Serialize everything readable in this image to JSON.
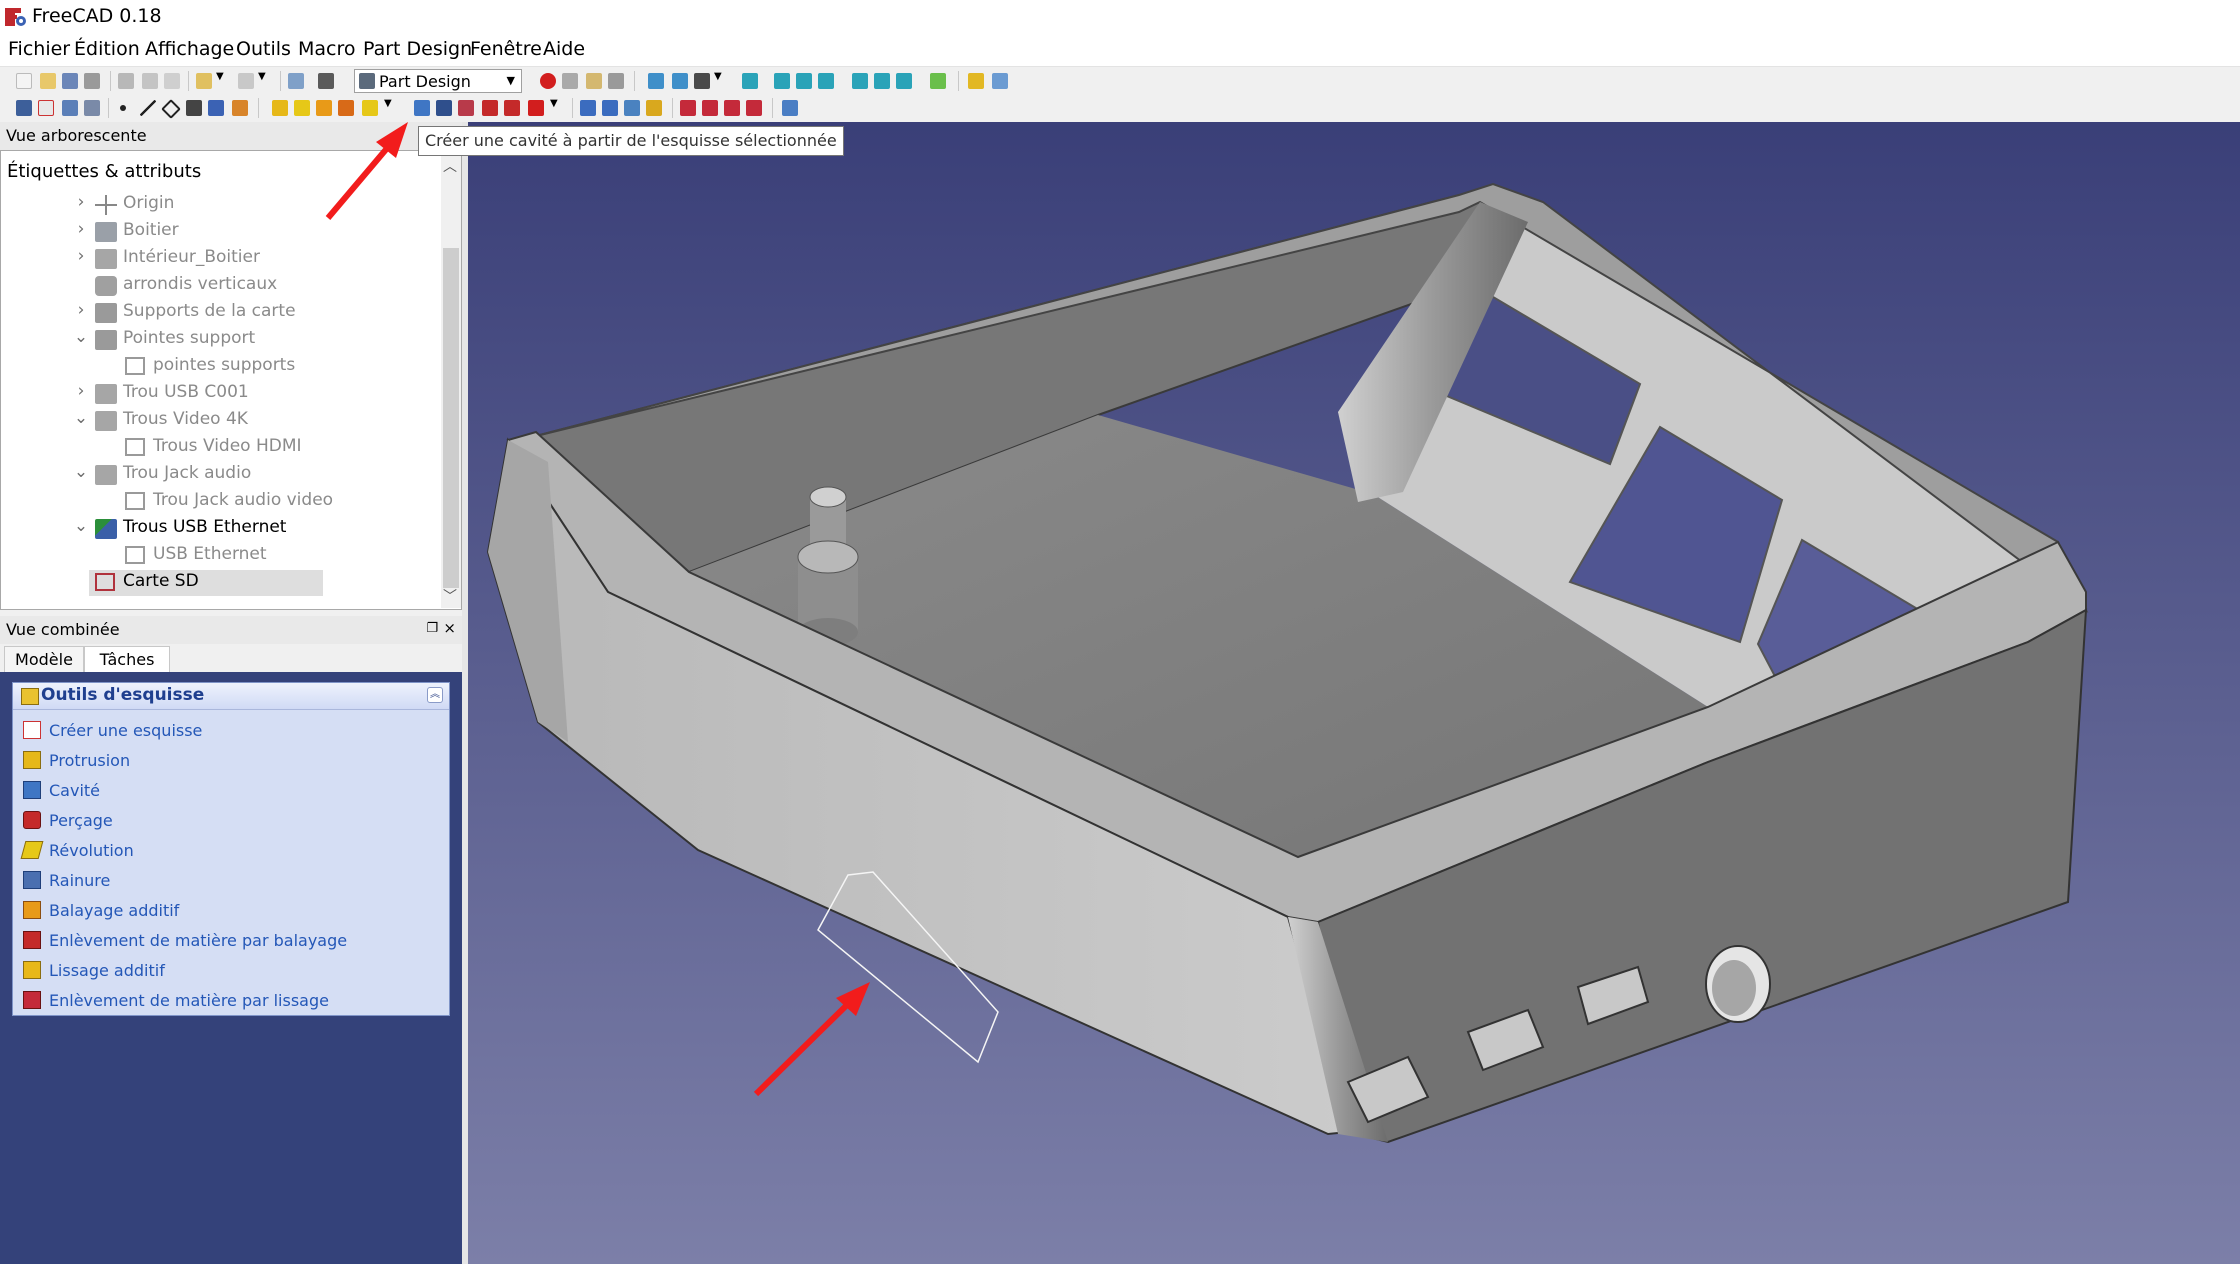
{
  "app": {
    "title": "FreeCAD 0.18"
  },
  "menu": [
    "Fichier",
    "Édition",
    "Affichage",
    "Outils",
    "Macro",
    "Part Design",
    "Fenêtre",
    "Aide"
  ],
  "toolbar": {
    "workbench": "Part Design"
  },
  "tooltip": "Créer une cavité à partir de l'esquisse sélectionnée",
  "tree": {
    "panel_title": "Vue arborescente",
    "column_header": "Étiquettes & attributs",
    "items": [
      {
        "label": "Origin",
        "icon": "origin-icon",
        "expander": "collapsed",
        "level": 0
      },
      {
        "label": "Boitier",
        "icon": "body-icon",
        "expander": "collapsed",
        "level": 0
      },
      {
        "label": "Intérieur_Boitier",
        "icon": "pocket-feature-icon",
        "expander": "collapsed",
        "level": 0
      },
      {
        "label": "arrondis verticaux",
        "icon": "fillet-feature-icon",
        "expander": "none",
        "level": 0
      },
      {
        "label": "Supports de la carte",
        "icon": "pad-feature-icon",
        "expander": "collapsed",
        "level": 0
      },
      {
        "label": "Pointes support",
        "icon": "pad-feature-icon",
        "expander": "expanded",
        "level": 0
      },
      {
        "label": "pointes supports",
        "icon": "sketch-icon",
        "expander": "none",
        "level": 1
      },
      {
        "label": "Trou USB C001",
        "icon": "pocket-feature-icon",
        "expander": "collapsed",
        "level": 0
      },
      {
        "label": "Trous Video 4K",
        "icon": "pocket-feature-icon",
        "expander": "expanded",
        "level": 0
      },
      {
        "label": "Trous Video HDMI",
        "icon": "sketch-icon",
        "expander": "none",
        "level": 1
      },
      {
        "label": "Trou Jack audio",
        "icon": "pocket-feature-icon",
        "expander": "expanded",
        "level": 0
      },
      {
        "label": "Trou Jack audio video",
        "icon": "sketch-icon",
        "expander": "none",
        "level": 1
      },
      {
        "label": "Trous USB Ethernet",
        "icon": "pocket-feature-tip-icon",
        "expander": "expanded",
        "level": 0,
        "active": true
      },
      {
        "label": "USB Ethernet",
        "icon": "sketch-icon",
        "expander": "none",
        "level": 1
      },
      {
        "label": "Carte SD",
        "icon": "sketch-selected-icon",
        "expander": "none",
        "level": 0,
        "active": true,
        "selected": true
      }
    ]
  },
  "combo": {
    "title": "Vue combinée",
    "tabs": [
      "Modèle",
      "Tâches"
    ],
    "active_tab": "Tâches",
    "tasks_title": "Outils d'esquisse",
    "tasks": [
      {
        "label": "Créer une esquisse",
        "icon": "new-sketch-icon"
      },
      {
        "label": "Protrusion",
        "icon": "pad-icon"
      },
      {
        "label": "Cavité",
        "icon": "pocket-icon"
      },
      {
        "label": "Perçage",
        "icon": "hole-icon"
      },
      {
        "label": "Révolution",
        "icon": "revolution-icon"
      },
      {
        "label": "Rainure",
        "icon": "groove-icon"
      },
      {
        "label": "Balayage additif",
        "icon": "additive-pipe-icon"
      },
      {
        "label": "Enlèvement de matière par balayage",
        "icon": "subtractive-pipe-icon"
      },
      {
        "label": "Lissage additif",
        "icon": "additive-loft-icon"
      },
      {
        "label": "Enlèvement de matière par lissage",
        "icon": "subtractive-loft-icon"
      }
    ]
  },
  "colors": {
    "view_top": "#3a3f78",
    "view_bottom": "#7c7fa8",
    "model_light": "#c8c8c8",
    "model_dark": "#6e6e6e",
    "annotation_arrow": "#ff0000",
    "task_text": "#2457b7"
  }
}
